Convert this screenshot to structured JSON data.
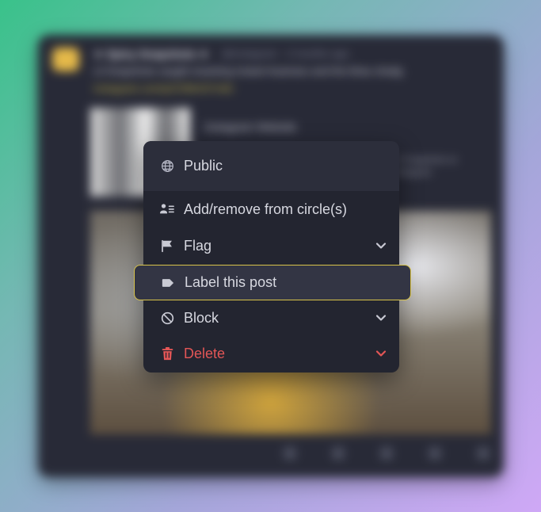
{
  "background_post": {
    "author_name": "★ Spíсy Snapshots ★",
    "author_handle": "@instagram · 2 months ago",
    "text": "Lil Snapshots caught snacking instant Asamaru and the bhas shadg",
    "link": "instagram.com/p/C5Mm5YmEr",
    "preview_title": "Instagram Website",
    "preview_description": "Lil Snapshots on Instagram"
  },
  "menu": {
    "visibility_label": "Public",
    "items": [
      {
        "label": "Add/remove from circle(s)",
        "icon": "people-list-icon",
        "has_chevron": false
      },
      {
        "label": "Flag",
        "icon": "flag-icon",
        "has_chevron": true
      },
      {
        "label": "Label this post",
        "icon": "tag-icon",
        "has_chevron": false
      },
      {
        "label": "Block",
        "icon": "block-icon",
        "has_chevron": true
      },
      {
        "label": "Delete",
        "icon": "trash-icon",
        "has_chevron": true
      }
    ]
  },
  "colors": {
    "menu_bg": "#232530",
    "menu_header_bg": "#2c2e3b",
    "highlight_border": "#d8c34a",
    "danger": "#e35656",
    "text": "#d7d8e0"
  }
}
